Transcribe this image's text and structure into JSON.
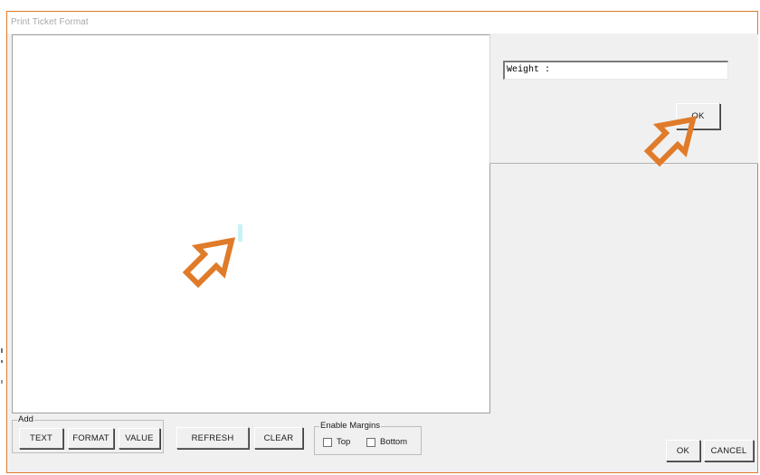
{
  "window": {
    "title": "Print Ticket Format"
  },
  "right_panel": {
    "weight_value": "Weight :",
    "ok_label": "OK"
  },
  "add_group": {
    "label": "Add",
    "buttons": [
      "TEXT",
      "FORMAT",
      "VALUE"
    ]
  },
  "toolbar": {
    "refresh_label": "REFRESH",
    "clear_label": "CLEAR"
  },
  "margins_group": {
    "label": "Enable Margins",
    "top_label": "Top",
    "bottom_label": "Bottom",
    "top_checked": false,
    "bottom_checked": false
  },
  "footer": {
    "ok_label": "OK",
    "cancel_label": "CANCEL"
  },
  "colors": {
    "annotation_arrow": "#e07b2a",
    "window_bg": "#f0f0f0",
    "cursor_mark": "#c8f2f8"
  },
  "icons": {
    "annotation": "arrow-up-right-outline-icon"
  }
}
